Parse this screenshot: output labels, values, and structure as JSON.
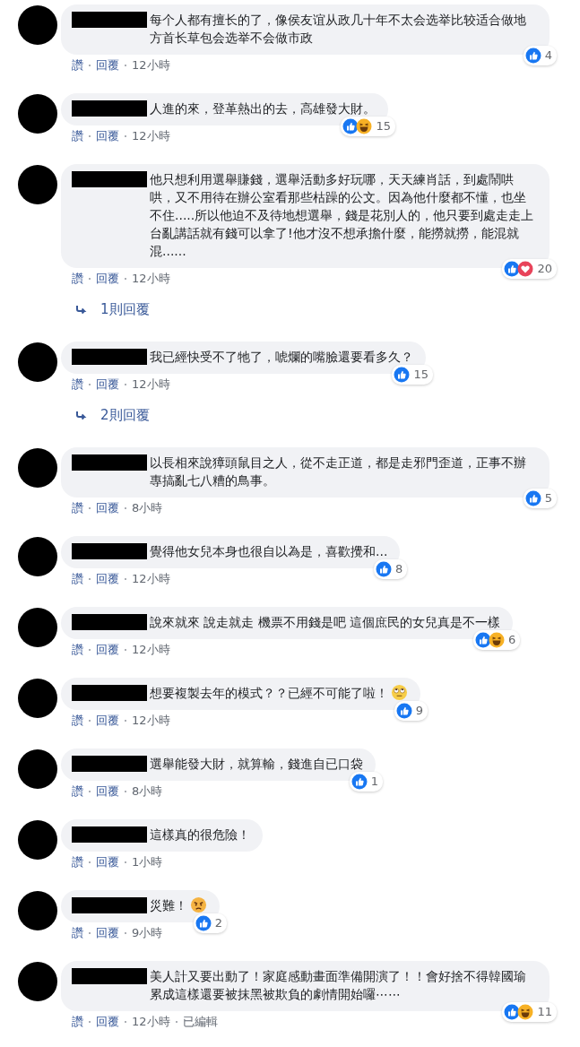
{
  "comments": [
    {
      "text": "每个人都有擅长的了，像侯友谊从政几十年不太会选举比较适合做地方首长草包会选举不会做市政",
      "reactions": [
        {
          "kind": "like"
        }
      ],
      "reaction_count": "4",
      "actions": [
        "讚",
        "回覆"
      ],
      "time": "12小時"
    },
    {
      "text": "人進的來，登革熱出的去，高雄發大財。",
      "reactions": [
        {
          "kind": "like"
        },
        {
          "kind": "haha"
        }
      ],
      "reaction_count": "15",
      "actions": [
        "讚",
        "回覆"
      ],
      "time": "12小時"
    },
    {
      "text": "他只想利用選舉賺錢，選舉活動多好玩哪，天天練肖話，到處鬧哄哄，又不用待在辦公室看那些枯躁的公文。因為他什麼都不懂，也坐不住.....所以他迫不及待地想選舉，錢是花別人的，他只要到處走走上台亂講話就有錢可以拿了!他才沒不想承擔什麼，能撈就撈，能混就混......",
      "reactions": [
        {
          "kind": "like"
        },
        {
          "kind": "love"
        }
      ],
      "reaction_count": "20",
      "actions": [
        "讚",
        "回覆"
      ],
      "time": "12小時",
      "replies_link": "1則回覆"
    },
    {
      "text": "我已經快受不了牠了，唬爛的嘴臉還要看多久？",
      "reactions": [
        {
          "kind": "like"
        }
      ],
      "reaction_count": "15",
      "actions": [
        "讚",
        "回覆"
      ],
      "time": "12小時",
      "replies_link": "2則回覆"
    },
    {
      "text": "以長相來說獐頭鼠目之人，從不走正道，都是走邪門歪道，正事不辦專搞亂七八糟的鳥事。",
      "reactions": [
        {
          "kind": "like"
        }
      ],
      "reaction_count": "5",
      "actions": [
        "讚",
        "回覆"
      ],
      "time": "8小時"
    },
    {
      "text": "覺得他女兒本身也很自以為是，喜歡攪和...",
      "reactions": [
        {
          "kind": "like"
        }
      ],
      "reaction_count": "8",
      "actions": [
        "讚",
        "回覆"
      ],
      "time": "12小時"
    },
    {
      "text": "說來就來 說走就走 機票不用錢是吧 這個庶民的女兒真是不一樣",
      "reactions": [
        {
          "kind": "like"
        },
        {
          "kind": "haha"
        }
      ],
      "reaction_count": "6",
      "actions": [
        "讚",
        "回覆"
      ],
      "time": "12小時"
    },
    {
      "text": "想要複製去年的模式？？已經不可能了啦！",
      "emoji": {
        "kind": "eye-roll"
      },
      "reactions": [
        {
          "kind": "like"
        }
      ],
      "reaction_count": "9",
      "actions": [
        "讚",
        "回覆"
      ],
      "time": "12小時"
    },
    {
      "text": "選舉能發大財，就算輸，錢進自已口袋",
      "reactions": [
        {
          "kind": "like"
        }
      ],
      "reaction_count": "1",
      "actions": [
        "讚",
        "回覆"
      ],
      "time": "8小時"
    },
    {
      "text": "這樣真的很危險！",
      "actions": [
        "讚",
        "回覆"
      ],
      "time": "1小時"
    },
    {
      "text": "災難！",
      "emoji": {
        "kind": "angry"
      },
      "reactions": [
        {
          "kind": "like"
        }
      ],
      "reaction_count": "2",
      "actions": [
        "讚",
        "回覆"
      ],
      "time": "9小時"
    },
    {
      "text": "美人計又要出動了！家庭感動畫面準備開演了！！會好捨不得韓國瑜累成這樣還要被抹黑被欺負的劇情開始囉⋯⋯",
      "reactions": [
        {
          "kind": "like"
        },
        {
          "kind": "haha"
        }
      ],
      "reaction_count": "11",
      "actions": [
        "讚",
        "回覆"
      ],
      "time": "12小時",
      "edited": "已編輯"
    }
  ]
}
